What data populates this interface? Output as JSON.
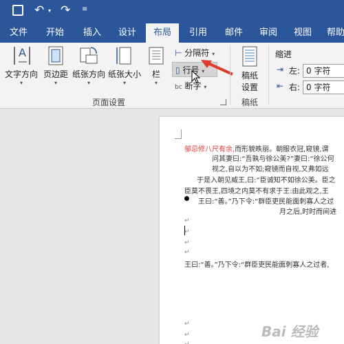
{
  "ribbon_tabs": [
    "文件",
    "开始",
    "插入",
    "设计",
    "布局",
    "引用",
    "邮件",
    "审阅",
    "视图",
    "帮助"
  ],
  "active_tab": "布局",
  "ribbon": {
    "text_direction": "文字方向",
    "margins": "页边距",
    "orientation": "纸张方向",
    "size": "纸张大小",
    "columns": "栏",
    "breaks": "分隔符",
    "line_numbers": "行号",
    "hyphenation": "断字",
    "page_setup_group": "页面设置",
    "manuscript": [
      "稿纸",
      "设置"
    ],
    "manuscript_group": "稿纸",
    "indent_title": "缩进",
    "indent_left_label": "左:",
    "indent_left_value": "0 字符",
    "indent_right_label": "右:",
    "indent_right_value": "0 字符"
  },
  "document": {
    "line1_red": "邹忌修八尺有余,",
    "line1_rest": "而形貌昳丽。朝服衣冠,窥镜,谓",
    "line2": "问其妻曰:“吾孰与徐公美?”妻曰:“徐公何",
    "line3": "视之,自以为不如;窥镜而自视,又弗如远",
    "line4": "于是入朝见威王,曰:“臣诚知不如徐公美。臣之",
    "line5": "臣莫不畏王,四境之内莫不有求于王:由此观之,王",
    "bullet_line": "王曰:“善。”乃下令:“群臣吏民能面刺寡人之过",
    "line7": "月之后,时时而间进",
    "last_line": "王曰:“善。”乃下令:“群臣吏民能面刺寡人之过者,",
    "para_mark": "↵"
  },
  "watermark": "Bai 经验"
}
